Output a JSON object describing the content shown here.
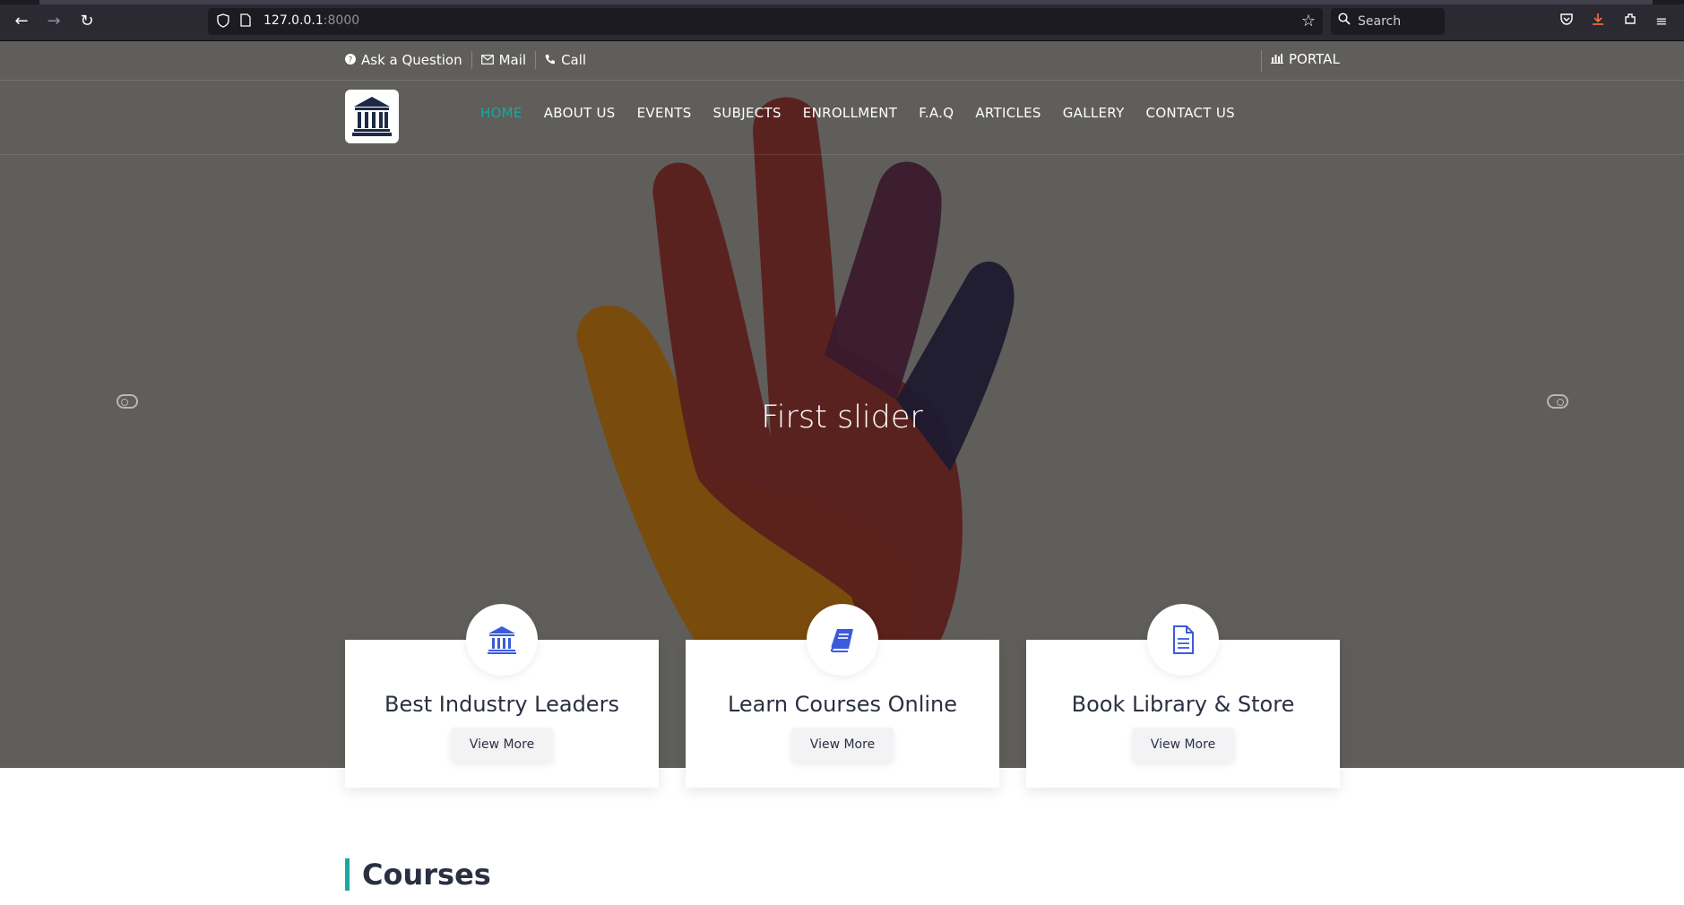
{
  "browser": {
    "url_host": "127.0.0.1",
    "url_port": ":8000",
    "search_placeholder": "Search"
  },
  "topbar": {
    "ask_label": "Ask a Question",
    "mail_label": "Mail",
    "call_label": "Call",
    "portal_label": "PORTAL"
  },
  "nav": {
    "items": [
      "HOME",
      "ABOUT US",
      "EVENTS",
      "SUBJECTS",
      "ENROLLMENT",
      "F.A.Q",
      "ARTICLES",
      "GALLERY",
      "CONTACT US"
    ],
    "active_index": 0
  },
  "hero": {
    "slide_title": "First slider"
  },
  "features": [
    {
      "title": "Best Industry Leaders",
      "button": "View More",
      "icon": "bank-icon"
    },
    {
      "title": "Learn Courses Online",
      "button": "View More",
      "icon": "book-icon"
    },
    {
      "title": "Book Library & Store",
      "button": "View More",
      "icon": "document-icon"
    }
  ],
  "courses": {
    "heading": "Courses"
  },
  "colors": {
    "accent": "#1aa89e",
    "icon_blue": "#3b5bdb",
    "hero_overlay": "#5f5e5b"
  }
}
